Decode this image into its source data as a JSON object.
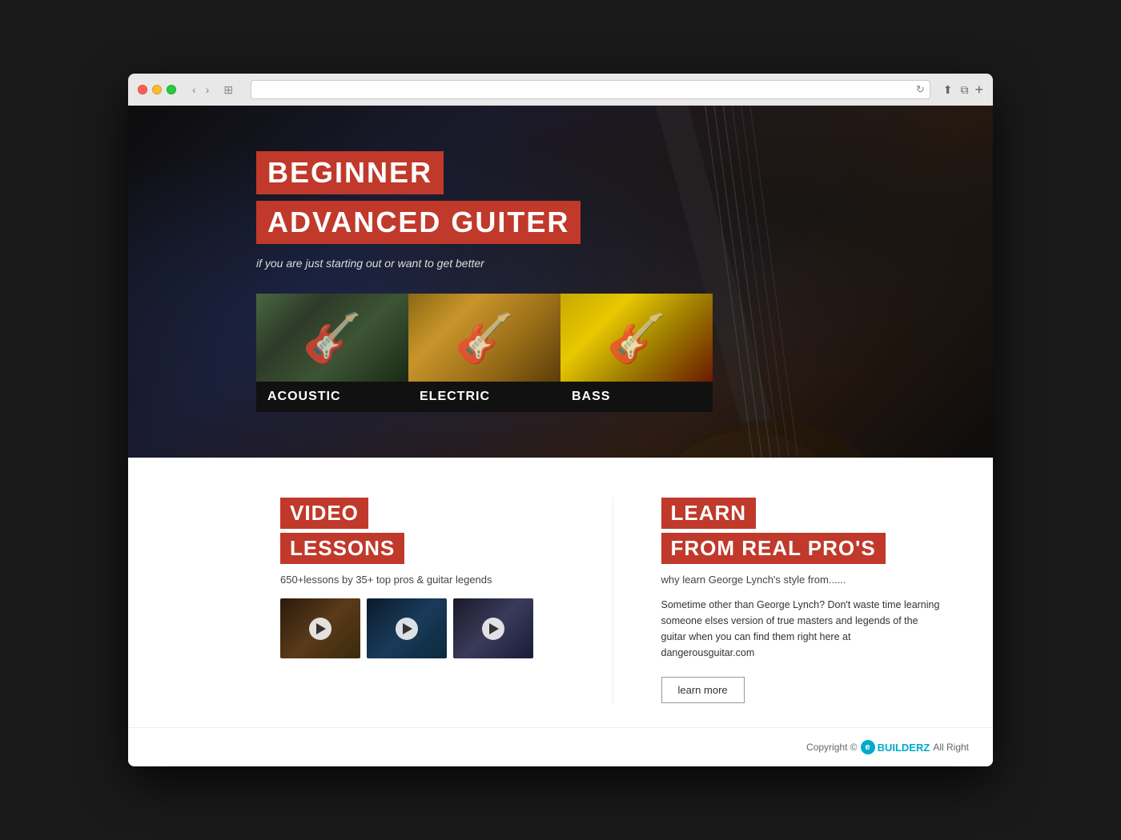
{
  "browser": {
    "traffic_lights": [
      "red",
      "yellow",
      "green"
    ],
    "nav_back": "‹",
    "nav_fwd": "›",
    "tab_icon": "⊞",
    "address_bar_text": "",
    "reload_icon": "↻",
    "toolbar_share": "⬆",
    "toolbar_windows": "⧉",
    "new_tab": "+"
  },
  "hero": {
    "title_line1": "BEGINNER",
    "title_line2": "ADVANCED GUITER",
    "subtitle": "if you are just starting out or want to get better",
    "cards": [
      {
        "label": "ACOUSTIC",
        "style": "acoustic"
      },
      {
        "label": "ELECTRIC",
        "style": "electric"
      },
      {
        "label": "BASS",
        "style": "bass"
      }
    ]
  },
  "video_section": {
    "title_line1": "VIDEO",
    "title_line2": "LESSONS",
    "subtitle": "650+lessons by 35+ top pros & guitar legends",
    "thumbnails": [
      {
        "label": "video-1"
      },
      {
        "label": "video-2"
      },
      {
        "label": "video-3"
      }
    ]
  },
  "pro_section": {
    "title_line1": "LEARN",
    "title_line2": "FROM REAL PRO'S",
    "description": "why learn George Lynch's style from......",
    "body_text": "Sometime other than George Lynch? Don't waste time learning someone elses version of true masters and legends of the guitar when you can find them right here at dangerousguitar.com",
    "learn_more_label": "learn more"
  },
  "footer": {
    "text": "Copyright ©",
    "brand_letter": "e",
    "brand_name": "BUILDERZ",
    "suffix": "All Right"
  }
}
